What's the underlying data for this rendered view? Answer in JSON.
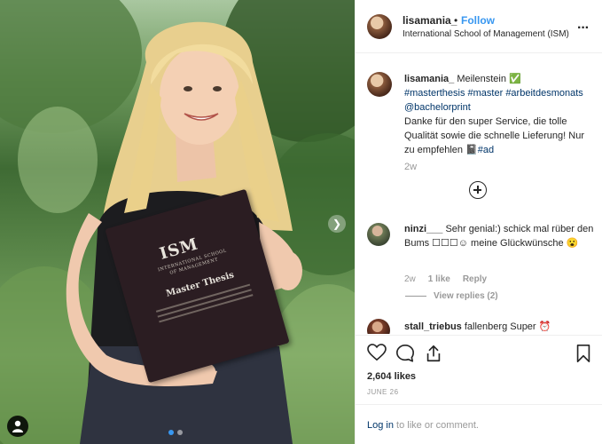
{
  "post": {
    "header": {
      "username": "lisamania_",
      "separator": "•",
      "follow_label": "Follow",
      "location": "International School of Management (ISM)",
      "more_icon": "more-horizontal-icon"
    },
    "image": {
      "book_logo": "ISM",
      "book_school": "INTERNATIONAL SCHOOL OF MANAGEMENT",
      "book_title": "Master Thesis",
      "next_icon": "chevron-right-icon",
      "tag_icon": "user-tag-icon",
      "carousel_slides": 2,
      "carousel_active": 1
    },
    "caption": {
      "username": "lisamania_",
      "text_1": " Meilenstein ✅",
      "hashtags": "#masterthesis #master #arbeitdesmonats",
      "mention": "@bachelorprint",
      "text_2": "Danke für den super Service, die tolle Qualität sowie die schnelle Lieferung! Nur zu empfehlen 📓",
      "hashtag_end": "#ad",
      "time": "2w"
    },
    "load_more_icon": "plus-circle-icon",
    "comments": [
      {
        "username": "ninzi___",
        "text": " Sehr genial:) schick mal rüber den Bums ☐☐☐☺ meine Glückwünsche 😮",
        "time": "2w",
        "likes": "1 like",
        "reply_label": "Reply",
        "view_replies": "View replies (2)"
      },
      {
        "username": "stall_triebus",
        "text": " fallenberg Super ⏰"
      }
    ],
    "actions": {
      "like_icon": "heart-icon",
      "comment_icon": "comment-icon",
      "share_icon": "share-icon",
      "save_icon": "bookmark-icon",
      "likes_count": "2,604 likes",
      "date": "JUNE 26"
    },
    "footer": {
      "login_label": "Log in",
      "login_suffix": " to like or comment."
    }
  }
}
